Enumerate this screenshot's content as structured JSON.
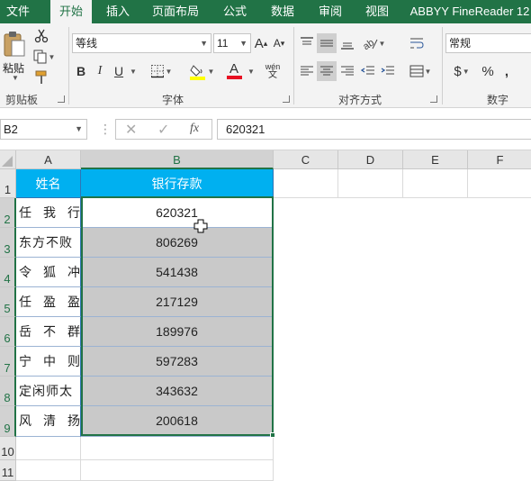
{
  "ribbon_tabs": [
    {
      "label": "文件"
    },
    {
      "label": "开始"
    },
    {
      "label": "插入"
    },
    {
      "label": "页面布局"
    },
    {
      "label": "公式"
    },
    {
      "label": "数据"
    },
    {
      "label": "审阅"
    },
    {
      "label": "视图"
    },
    {
      "label": "ABBYY FineReader 12"
    }
  ],
  "clipboard": {
    "paste_label": "粘贴",
    "group_label": "剪贴板"
  },
  "font": {
    "name": "等线",
    "size": "11",
    "group_label": "字体",
    "bold": "B",
    "italic": "I",
    "underline": "U",
    "grow": "A",
    "shrink": "A",
    "font_color_letter": "A",
    "phonetic": "wén",
    "fill_color": "#ffff00",
    "font_color": "#e81123"
  },
  "alignment": {
    "group_label": "对齐方式"
  },
  "number": {
    "format": "常规",
    "group_label": "数字",
    "currency": "$",
    "percent": "%"
  },
  "formula_bar": {
    "name_box": "B2",
    "formula": "620321",
    "fx": "fx"
  },
  "sheet": {
    "columns": [
      "A",
      "B",
      "C",
      "D",
      "E",
      "F"
    ],
    "rows": [
      "1",
      "2",
      "3",
      "4",
      "5",
      "6",
      "7",
      "8",
      "9",
      "10",
      "11"
    ],
    "header_row": {
      "a": "姓名",
      "b": "银行存款"
    },
    "data_rows": [
      {
        "name": "任我行",
        "value": "620321"
      },
      {
        "name": "东方不败",
        "value": "806269"
      },
      {
        "name": "令狐冲",
        "value": "541438"
      },
      {
        "name": "任盈盈",
        "value": "217129"
      },
      {
        "name": "岳不群",
        "value": "189976"
      },
      {
        "name": "宁中则",
        "value": "597283"
      },
      {
        "name": "定闲师太",
        "value": "343632"
      },
      {
        "name": "风清扬",
        "value": "200618"
      }
    ],
    "header_fill": "#00b0f0",
    "selection_color": "#217346"
  }
}
